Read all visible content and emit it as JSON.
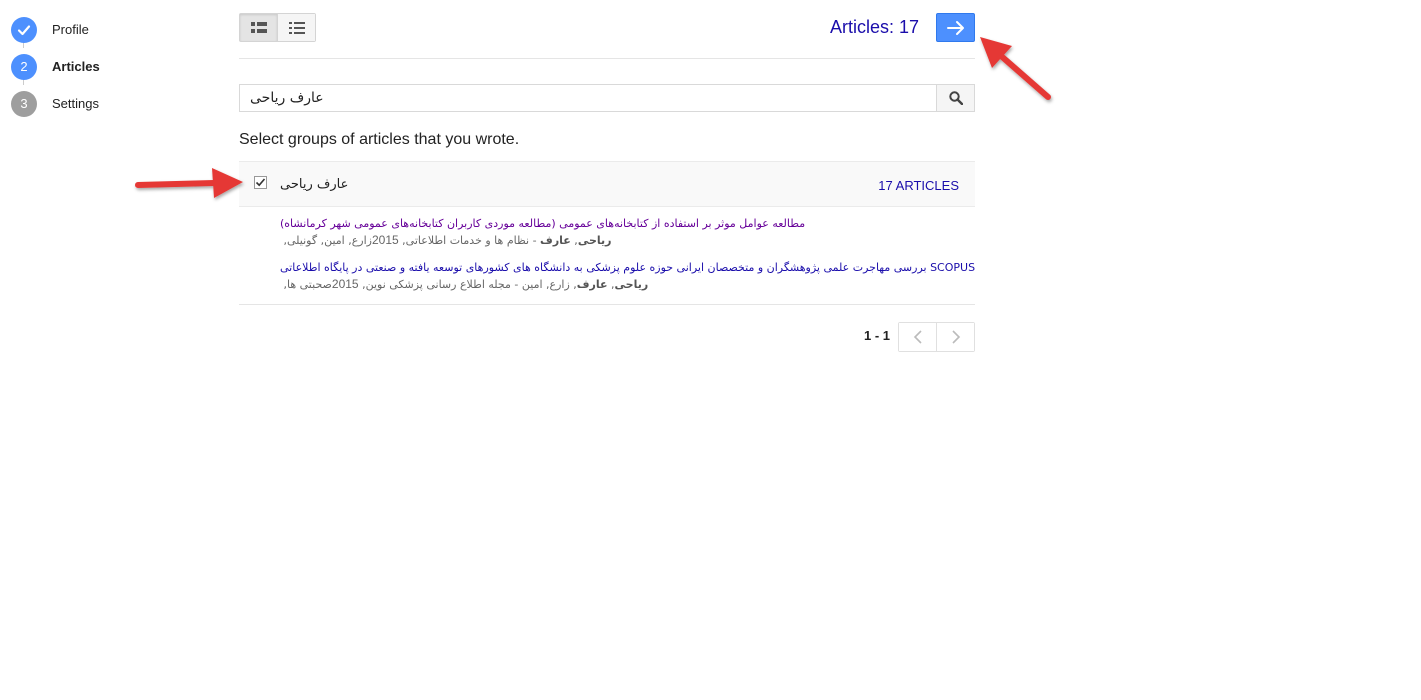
{
  "steps": [
    {
      "number": "",
      "label": "Profile",
      "state": "done"
    },
    {
      "number": "2",
      "label": "Articles",
      "state": "active"
    },
    {
      "number": "3",
      "label": "Settings",
      "state": "pending"
    }
  ],
  "toolbar": {
    "view_modes": [
      "group-view",
      "list-view"
    ],
    "selected_view": "group-view",
    "article_count": "Articles: 17"
  },
  "search": {
    "value": "عارف رياحی"
  },
  "instruction": "Select groups of articles that you wrote.",
  "group": {
    "checked": true,
    "name": "عارف رياحی",
    "count_label": "17 articles"
  },
  "articles": [
    {
      "title": "مطالعه عوامل موثر بر استفاده از کتابخانه‌های عمومی (مطالعه موردی کاربران کتابخانه‌های عمومی شهر کرمانشاه)",
      "authors_pre": "زارع, امين, گونيلی, ",
      "author_bold_1": "رياحی",
      "sep": ", ",
      "author_bold_2": "عارف",
      "venue": " - نظام ها و خدمات اطلاعاتی, ",
      "year": "2015",
      "visited": true
    },
    {
      "title": "بررسی مهاجرت علمی پژوهشگران و متخصصان ايرانی حوزه علوم پزشکی به دانشگاه های کشورهای توسعه يافته و صنعتی در پايگاه اطلاعاتی SCOPUS",
      "authors_pre": "صحبتی ها, ",
      "author_bold_1": "رياحی",
      "sep": ", ",
      "author_bold_2": "عارف",
      "venue": ", زارع, امين - مجله اطلاع رسانی پزشکی نوين, ",
      "year": "2015",
      "visited": false
    }
  ],
  "pagination": {
    "range": "1 - 1"
  },
  "colors": {
    "accent_blue": "#4d90fe",
    "link_blue": "#1a0dab",
    "visited_purple": "#660099",
    "annotation_red": "#e53935"
  }
}
